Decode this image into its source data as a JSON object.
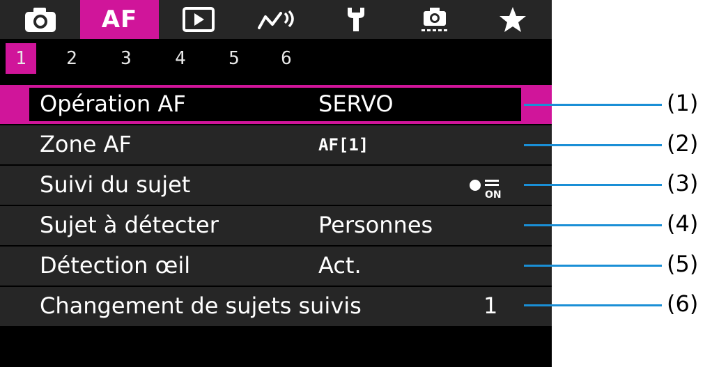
{
  "menu_tabs": [
    {
      "icon": "camera-icon"
    },
    {
      "label": "AF"
    },
    {
      "icon": "playback-icon"
    },
    {
      "icon": "wireless-icon"
    },
    {
      "icon": "wrench-icon"
    },
    {
      "icon": "custom-function-icon"
    },
    {
      "icon": "star-icon"
    }
  ],
  "sub_tabs": [
    "1",
    "2",
    "3",
    "4",
    "5",
    "6"
  ],
  "items": [
    {
      "label": "Opération AF",
      "value": "SERVO"
    },
    {
      "label": "Zone AF",
      "value": "AF[1]"
    },
    {
      "label": "Suivi du sujet",
      "value_icon": "subject-tracking-on-icon",
      "value_icon_text": "ON"
    },
    {
      "label": "Sujet à détecter",
      "value": "Personnes"
    },
    {
      "label": "Détection œil",
      "value": "Act."
    },
    {
      "label": "Changement de sujets suivis",
      "value": "1"
    }
  ],
  "callouts": [
    "(1)",
    "(2)",
    "(3)",
    "(4)",
    "(5)",
    "(6)"
  ],
  "colors": {
    "accent": "#d0159a",
    "row_bg": "#262626",
    "callout_line": "#1a8fd6"
  }
}
